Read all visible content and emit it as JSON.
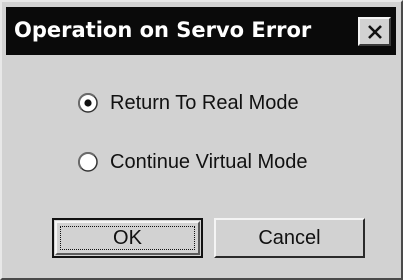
{
  "window": {
    "title": "Operation on Servo Error",
    "close_icon": "close-icon"
  },
  "options": [
    {
      "label": "Return To Real Mode",
      "selected": true
    },
    {
      "label": "Continue Virtual Mode",
      "selected": false
    }
  ],
  "buttons": {
    "ok_label": "OK",
    "cancel_label": "Cancel"
  },
  "colors": {
    "title_bar": "#0a0a0a",
    "dialog_face": "#d2d2d2"
  }
}
